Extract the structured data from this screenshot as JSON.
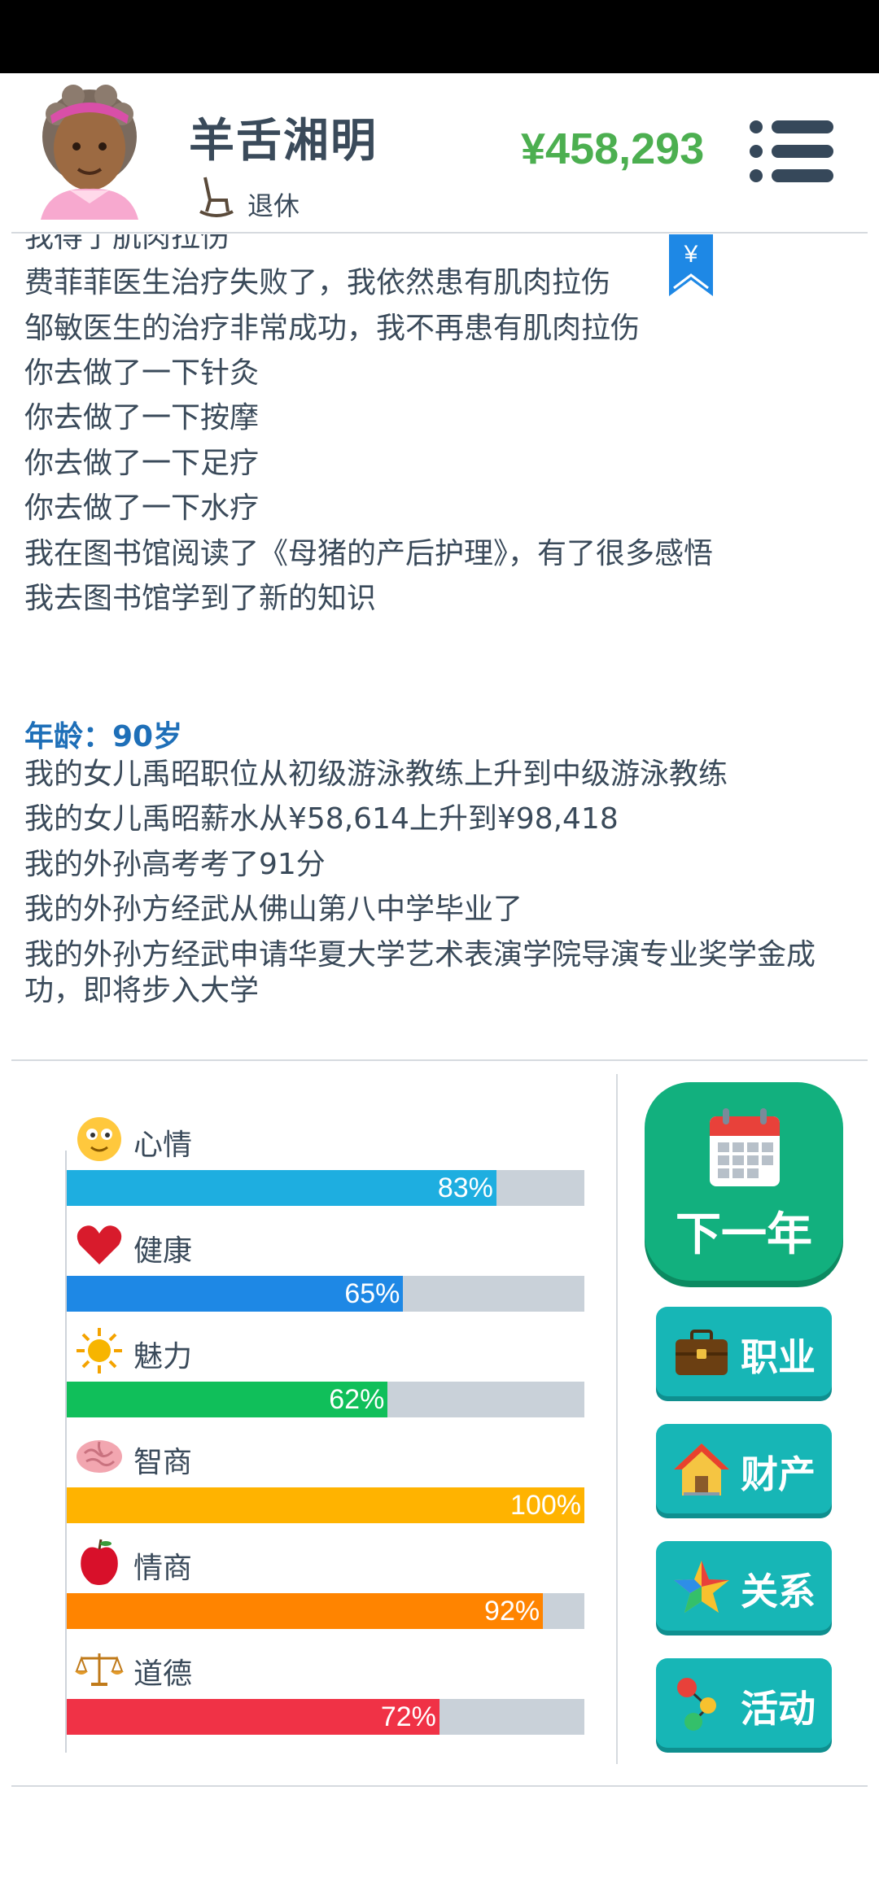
{
  "header": {
    "player_name": "羊舌湘明",
    "occupation": "退休",
    "money": "¥458,293"
  },
  "log": {
    "lines_before": [
      "我得了肌肉拉伤",
      "费菲菲医生治疗失败了，我依然患有肌肉拉伤",
      "邹敏医生的治疗非常成功，我不再患有肌肉拉伤",
      "你去做了一下针灸",
      "你去做了一下按摩",
      "你去做了一下足疗",
      "你去做了一下水疗",
      "我在图书馆阅读了《母猪的产后护理》，有了很多感悟",
      "我去图书馆学到了新的知识"
    ],
    "age_heading": "年龄：90岁",
    "lines_after": [
      "我的女儿禹昭职位从初级游泳教练上升到中级游泳教练",
      "我的女儿禹昭薪水从¥58,614上升到¥98,418",
      "我的外孙高考考了91分",
      "我的外孙方经武从佛山第八中学毕业了",
      "我的外孙方经武申请华夏大学艺术表演学院导演专业奖学金成功，即将步入大学"
    ],
    "bookmark_symbol": "¥"
  },
  "stats": [
    {
      "label": "心情",
      "percent": 83,
      "text": "83%",
      "color": "#1eaee0",
      "icon": "smiley-icon"
    },
    {
      "label": "健康",
      "percent": 65,
      "text": "65%",
      "color": "#1e88e5",
      "icon": "heart-icon"
    },
    {
      "label": "魅力",
      "percent": 62,
      "text": "62%",
      "color": "#10bf5a",
      "icon": "sun-icon"
    },
    {
      "label": "智商",
      "percent": 100,
      "text": "100%",
      "color": "#ffb300",
      "icon": "brain-icon"
    },
    {
      "label": "情商",
      "percent": 92,
      "text": "92%",
      "color": "#ff8400",
      "icon": "apple-icon"
    },
    {
      "label": "道德",
      "percent": 72,
      "text": "72%",
      "color": "#f03246",
      "icon": "scales-icon"
    }
  ],
  "actions": {
    "next_year": "下一年",
    "career": "职业",
    "assets": "财产",
    "relations": "关系",
    "activities": "活动"
  }
}
